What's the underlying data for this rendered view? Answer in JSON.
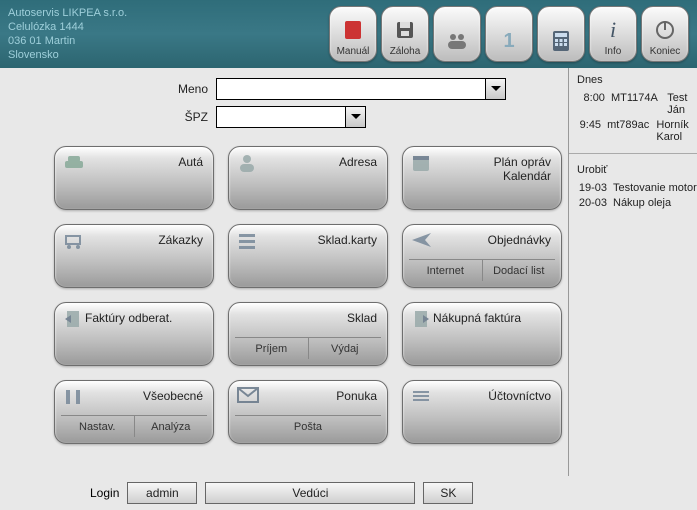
{
  "company": {
    "name": "Autoservis LIKPEA s.r.o.",
    "street": "Celulózka 1444",
    "city": "036 01 Martin",
    "country": "Slovensko"
  },
  "header_buttons": {
    "manual": "Manuál",
    "backup": "Záloha",
    "team": "",
    "num": "1",
    "calc": "",
    "info": "Info",
    "exit": "Koniec"
  },
  "form": {
    "meno_label": "Meno",
    "spz_label": "ŠPZ"
  },
  "tiles": {
    "auta": "Autá",
    "adresa": "Adresa",
    "plan1": "Plán opráv",
    "plan2": "Kalendár",
    "zakazky": "Zákazky",
    "skladkarty": "Sklad.karty",
    "objednavky": "Objednávky",
    "obj_sub1": "Internet",
    "obj_sub2": "Dodací list",
    "faktury": "Faktúry odberat.",
    "sklad": "Sklad",
    "sklad_sub1": "Príjem",
    "sklad_sub2": "Výdaj",
    "nakupna": "Nákupná faktúra",
    "vseobecne": "Všeobecné",
    "vseo_sub1": "Nastav.",
    "vseo_sub2": "Analýza",
    "ponuka": "Ponuka",
    "ponuka_sub": "Pošta",
    "uctovnictvo": "Účtovníctvo"
  },
  "today": {
    "title": "Dnes",
    "rows": [
      {
        "time": "8:00",
        "plate": "MT1174A",
        "name": "Test Ján"
      },
      {
        "time": "9:45",
        "plate": "mt789ac",
        "name": "Horník Karol"
      }
    ]
  },
  "todo": {
    "title": "Urobiť",
    "rows": [
      {
        "date": "19-03",
        "text": "Testovanie motora"
      },
      {
        "date": "20-03",
        "text": "Nákup oleja"
      }
    ]
  },
  "footer": {
    "login_label": "Login",
    "login_value": "admin",
    "role_value": "Vedúci",
    "lang_value": "SK"
  }
}
